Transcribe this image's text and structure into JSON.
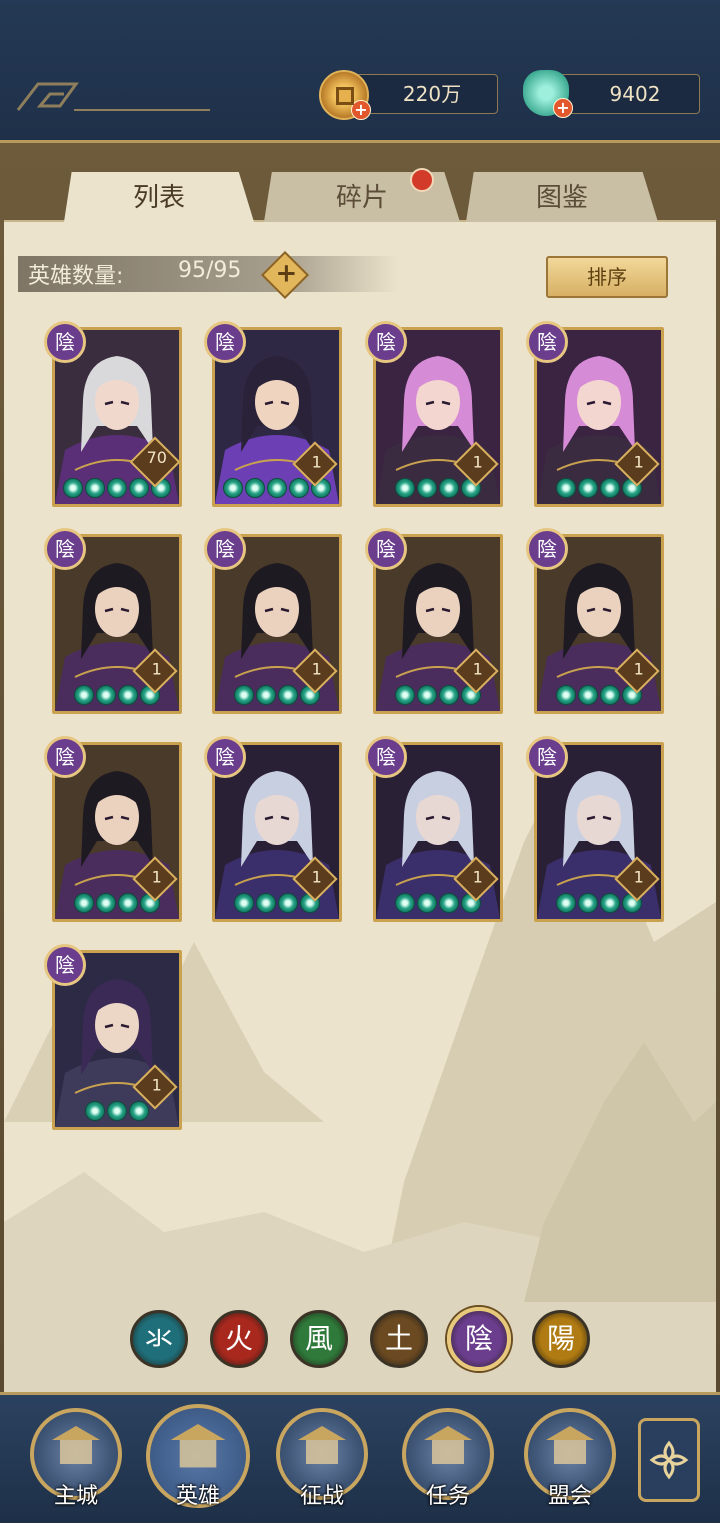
{
  "currency": {
    "coins": "220万",
    "jade": "9402"
  },
  "tabs": [
    {
      "label": "列表",
      "active": true
    },
    {
      "label": "碎片",
      "active": false,
      "badge": true
    },
    {
      "label": "图鉴",
      "active": false
    }
  ],
  "hero_count": {
    "label": "英雄数量:",
    "value": "95/95"
  },
  "sort_label": "排序",
  "heroes": [
    {
      "element": "陰",
      "level": "70",
      "stars": 5,
      "portrait": "masked-woman"
    },
    {
      "element": "陰",
      "level": "1",
      "stars": 5,
      "portrait": "headband-man"
    },
    {
      "element": "陰",
      "level": "1",
      "stars": 4,
      "portrait": "pink-hair-woman"
    },
    {
      "element": "陰",
      "level": "1",
      "stars": 4,
      "portrait": "pink-hair-woman"
    },
    {
      "element": "陰",
      "level": "1",
      "stars": 4,
      "portrait": "dark-hair-warrior"
    },
    {
      "element": "陰",
      "level": "1",
      "stars": 4,
      "portrait": "dark-hair-warrior"
    },
    {
      "element": "陰",
      "level": "1",
      "stars": 4,
      "portrait": "dark-hair-warrior"
    },
    {
      "element": "陰",
      "level": "1",
      "stars": 4,
      "portrait": "dark-hair-warrior"
    },
    {
      "element": "陰",
      "level": "1",
      "stars": 4,
      "portrait": "dark-hair-warrior"
    },
    {
      "element": "陰",
      "level": "1",
      "stars": 4,
      "portrait": "hat-assassin"
    },
    {
      "element": "陰",
      "level": "1",
      "stars": 4,
      "portrait": "hat-assassin"
    },
    {
      "element": "陰",
      "level": "1",
      "stars": 4,
      "portrait": "hat-assassin"
    },
    {
      "element": "陰",
      "level": "1",
      "stars": 3,
      "portrait": "long-hair-scholar"
    }
  ],
  "element_filters": [
    {
      "glyph": "氺",
      "color": "#1f6f7a",
      "selected": false
    },
    {
      "glyph": "火",
      "color": "#a8281e",
      "selected": false
    },
    {
      "glyph": "風",
      "color": "#2f7a3a",
      "selected": false
    },
    {
      "glyph": "土",
      "color": "#6b4a22",
      "selected": false
    },
    {
      "glyph": "陰",
      "color": "#6b3d8d",
      "selected": true
    },
    {
      "glyph": "陽",
      "color": "#b07b12",
      "selected": false
    }
  ],
  "nav": [
    {
      "label": "主城",
      "icon": "city-gate-icon"
    },
    {
      "label": "英雄",
      "icon": "hero-portrait-icon",
      "active": true
    },
    {
      "label": "征战",
      "icon": "war-drum-icon"
    },
    {
      "label": "任务",
      "icon": "scroll-task-icon"
    },
    {
      "label": "盟会",
      "icon": "alliance-hall-icon"
    }
  ],
  "nav_menu_icon": "menu-flower-icon"
}
